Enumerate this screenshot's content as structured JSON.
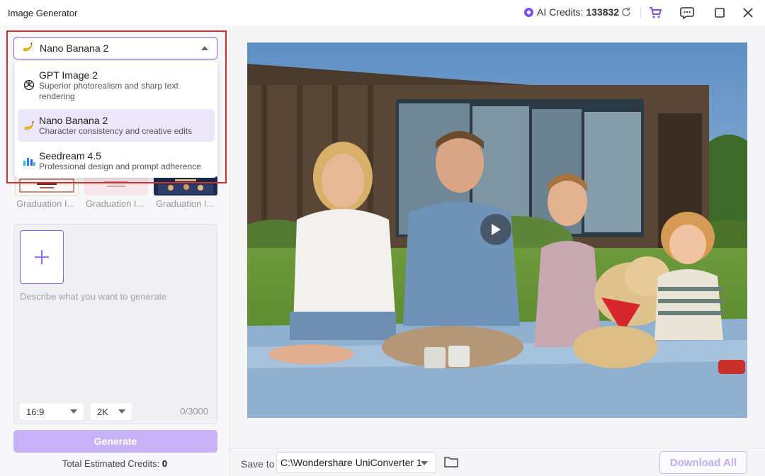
{
  "window": {
    "title": "Image Generator"
  },
  "credits": {
    "label": "AI Credits:",
    "value": "133832"
  },
  "model_select": {
    "selected": "Nano Banana 2",
    "options": [
      {
        "name": "GPT Image 2",
        "desc": "Superior photorealism and sharp text rendering",
        "icon": "openai-icon"
      },
      {
        "name": "Nano Banana 2",
        "desc": "Character consistency and creative edits",
        "icon": "banana-icon",
        "selected": true
      },
      {
        "name": "Seedream 4.5",
        "desc": "Professional design and prompt adherence",
        "icon": "seedream-icon"
      }
    ]
  },
  "templates": [
    {
      "label": "Graduation I..."
    },
    {
      "label": "Graduation I..."
    },
    {
      "label": "Graduation I..."
    }
  ],
  "prompt": {
    "placeholder": "Describe what you want to generate",
    "counter": "0/3000"
  },
  "options": {
    "aspect": "16:9",
    "resolution": "2K"
  },
  "generate": {
    "label": "Generate"
  },
  "total_credits": {
    "label": "Total Estimated Credits:",
    "value": "0"
  },
  "bottom": {
    "save_label": "Save to",
    "path": "C:\\Wondershare UniConverter 1",
    "download_label": "Download All"
  },
  "colors": {
    "accent": "#8a5cf6",
    "generate_disabled": "#c7b2f7",
    "highlight": "#d32f2f"
  }
}
